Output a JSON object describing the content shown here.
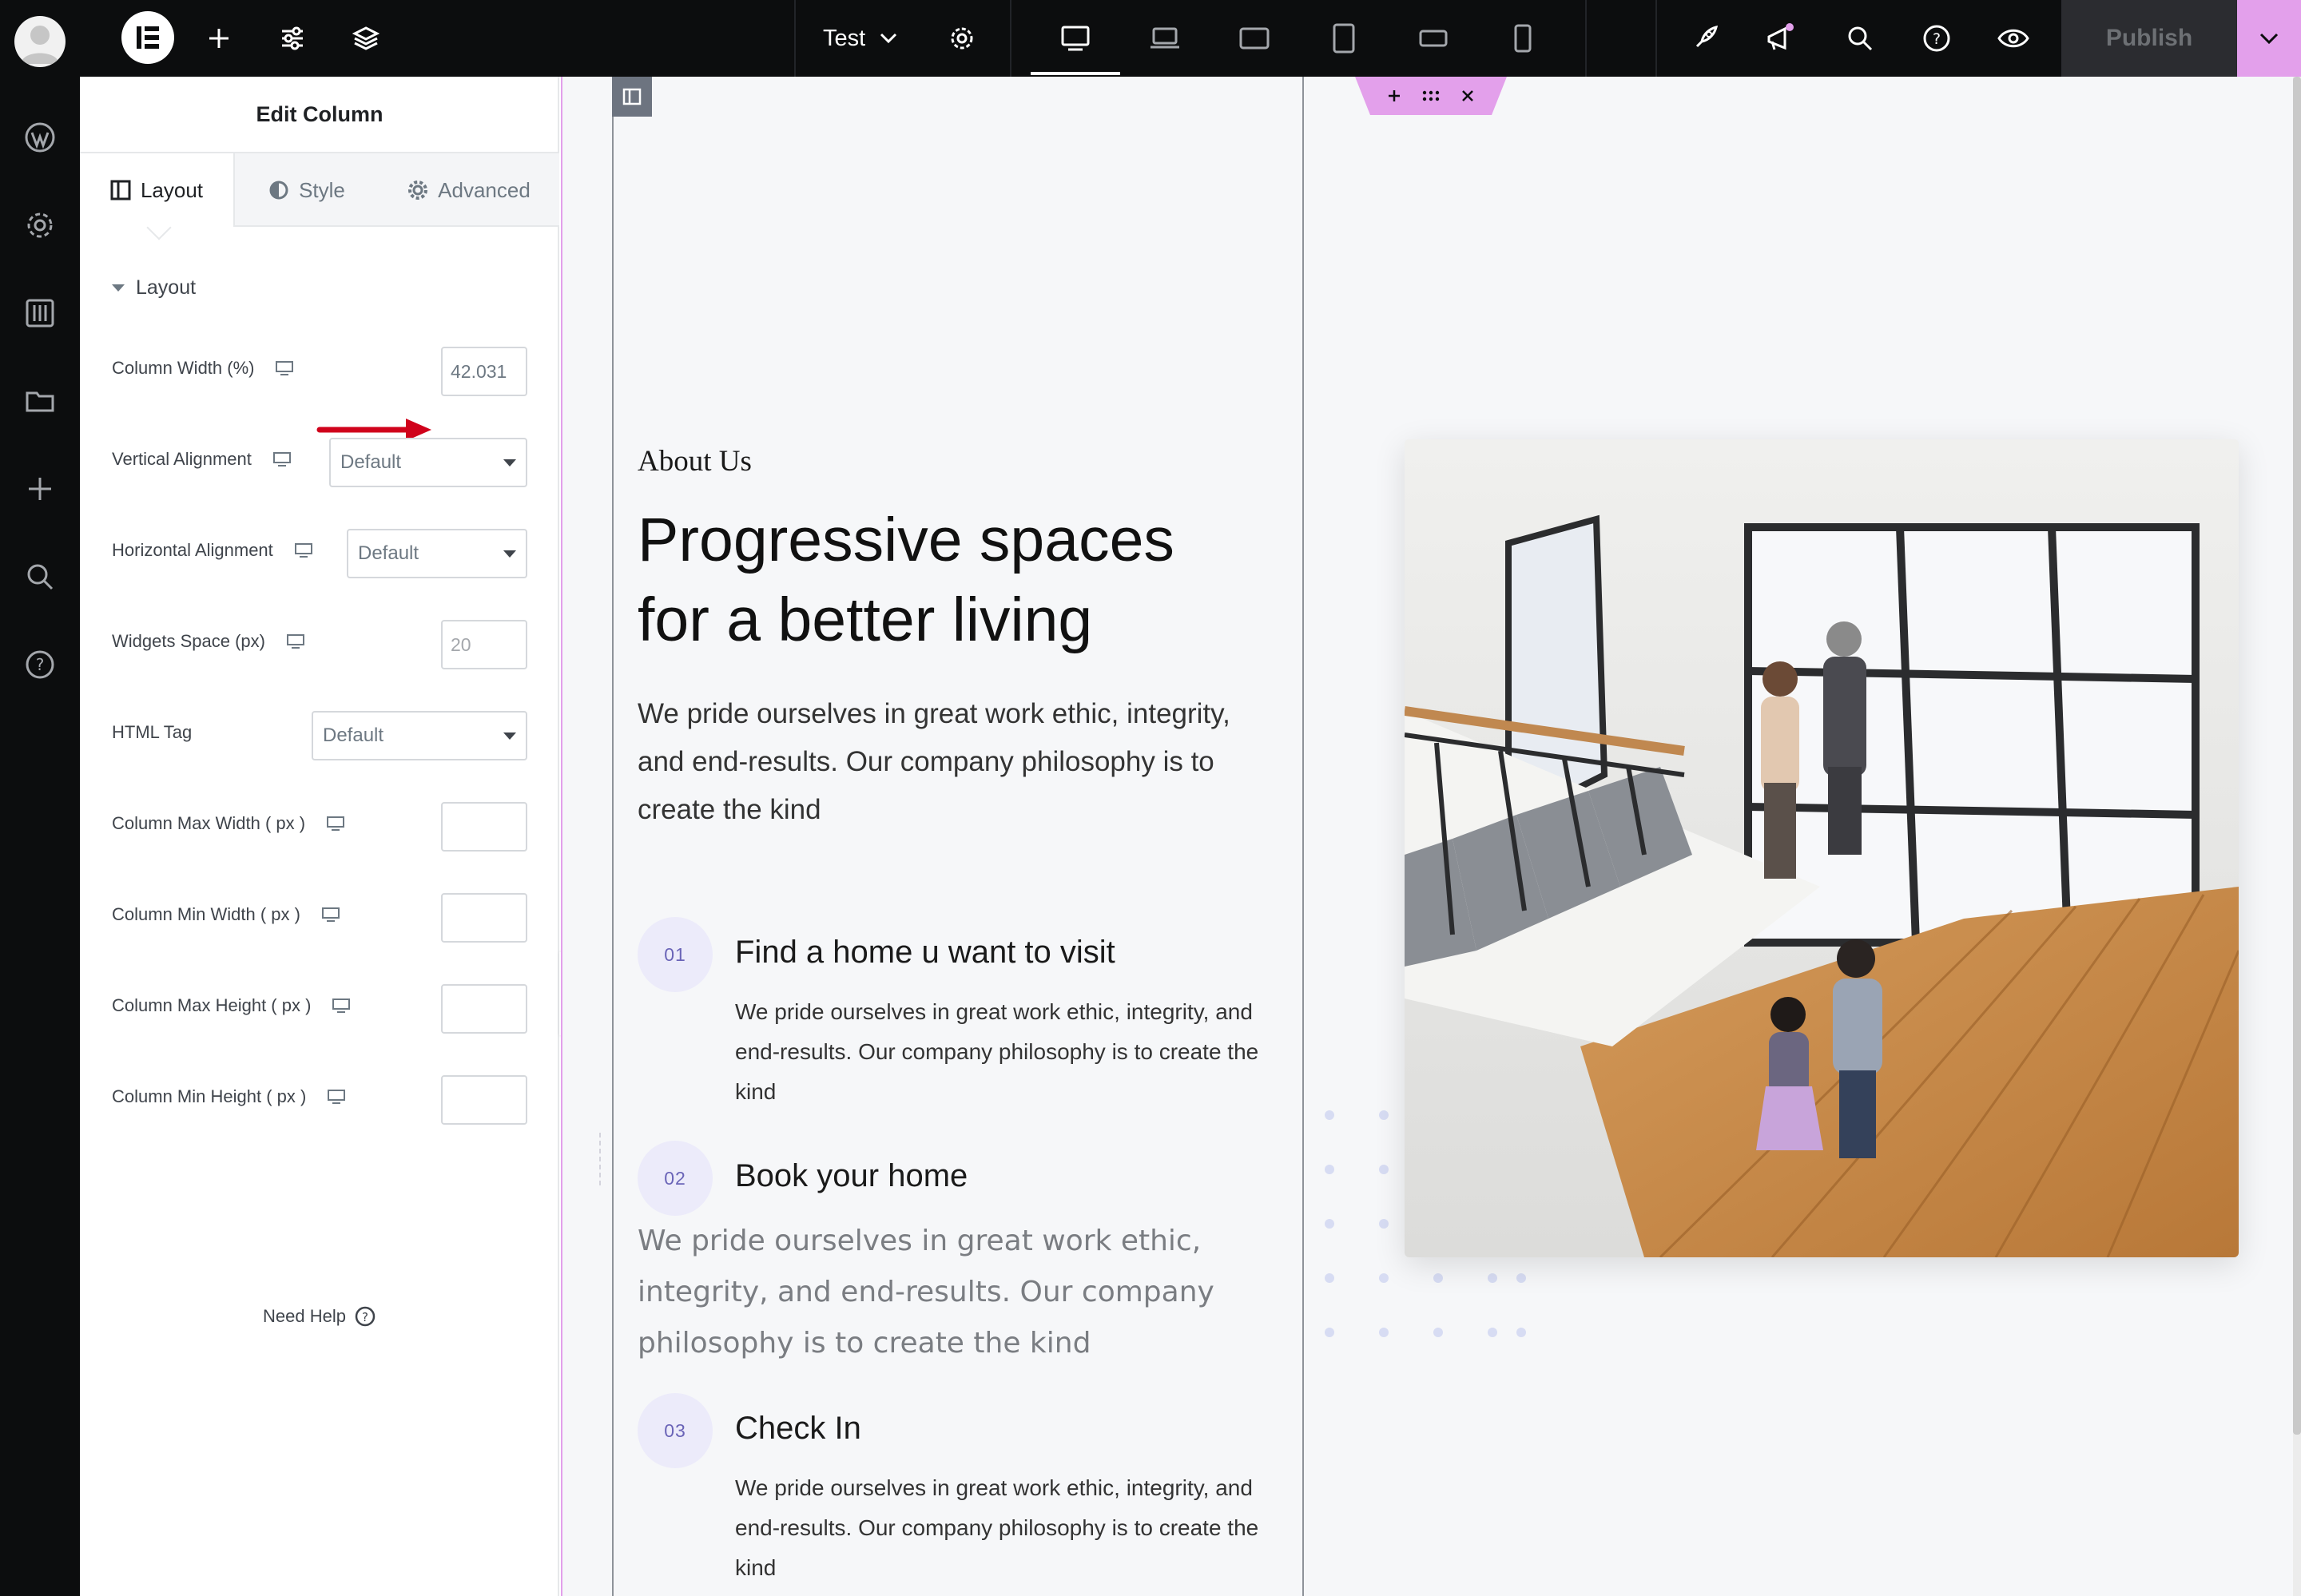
{
  "topbar": {
    "page_title": "Test",
    "publish_label": "Publish"
  },
  "panel": {
    "title": "Edit Column",
    "tabs": [
      {
        "label": "Layout"
      },
      {
        "label": "Style"
      },
      {
        "label": "Advanced"
      }
    ],
    "section_title": "Layout",
    "controls": {
      "column_width": {
        "label": "Column Width (%)",
        "value": "42.031"
      },
      "vertical_alignment": {
        "label": "Vertical Alignment",
        "value": "Default"
      },
      "horizontal_alignment": {
        "label": "Horizontal Alignment",
        "value": "Default"
      },
      "widgets_space": {
        "label": "Widgets Space (px)",
        "placeholder": "20"
      },
      "html_tag": {
        "label": "HTML Tag",
        "value": "Default"
      },
      "column_max_width": {
        "label": "Column Max Width ( px )",
        "value": ""
      },
      "column_min_width": {
        "label": "Column Min Width ( px )",
        "value": ""
      },
      "column_max_height": {
        "label": "Column Max Height ( px )",
        "value": ""
      },
      "column_min_height": {
        "label": "Column Min Height ( px )",
        "value": ""
      }
    },
    "need_help": "Need Help"
  },
  "content": {
    "about_label": "About Us",
    "headline_line1": "Progressive spaces",
    "headline_line2": "for a better living",
    "intro": "We pride ourselves in great work ethic, integrity, and end-results. Our company philosophy is to create the kind",
    "steps": [
      {
        "number": "01",
        "title": "Find a home u want to visit",
        "desc": "We pride ourselves in great work ethic, integrity, and end-results. Our company philosophy is to create the kind"
      },
      {
        "number": "02",
        "title": "Book your home",
        "desc": "We pride ourselves in great work ethic, integrity, and end-results. Our company philosophy is to create the kind"
      },
      {
        "number": "03",
        "title": "Check In",
        "desc": "We pride ourselves in great work ethic, integrity, and end-results. Our company philosophy is to create the kind"
      }
    ]
  },
  "icons": {
    "rail": [
      "wordpress-icon",
      "settings-icon",
      "sliders-icon",
      "folder-icon",
      "plus-icon",
      "search-icon",
      "help-icon"
    ],
    "topbar": [
      "elementor-logo-icon",
      "add-icon",
      "site-settings-icon",
      "structure-icon",
      "page-settings-icon",
      "desktop-icon",
      "laptop-icon",
      "tablet-landscape-icon",
      "tablet-portrait-icon",
      "mobile-landscape-icon",
      "mobile-portrait-icon",
      "launch-icon",
      "whats-new-icon",
      "finder-icon",
      "help-icon",
      "preview-icon"
    ]
  },
  "colors": {
    "accent_pink": "#e3a0eb",
    "dark_bar": "#0c0d0e",
    "step_badge_bg": "#ecebfa",
    "step_badge_text": "#6a64b7",
    "annotation_arrow": "#d0021b"
  }
}
